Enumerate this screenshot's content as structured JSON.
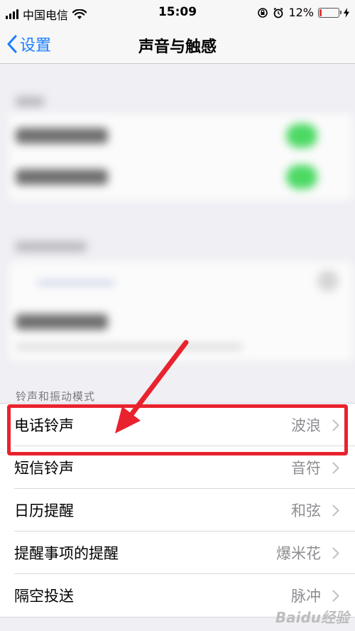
{
  "status_bar": {
    "carrier": "中国电信",
    "time": "15:09",
    "battery_percent": "12%",
    "battery_level": 0.12,
    "battery_color": "#e53935"
  },
  "nav": {
    "back_label": "设置",
    "title": "声音与触感",
    "accent_color": "#1a7dff"
  },
  "ringtone_section": {
    "header": "铃声和振动模式",
    "rows": [
      {
        "label": "电话铃声",
        "value": "波浪"
      },
      {
        "label": "短信铃声",
        "value": "音符"
      },
      {
        "label": "日历提醒",
        "value": "和弦"
      },
      {
        "label": "提醒事项的提醒",
        "value": "爆米花"
      },
      {
        "label": "隔空投送",
        "value": "脉冲"
      }
    ]
  },
  "watermark": "Baidu经验",
  "annotation_color": "#e8232e"
}
